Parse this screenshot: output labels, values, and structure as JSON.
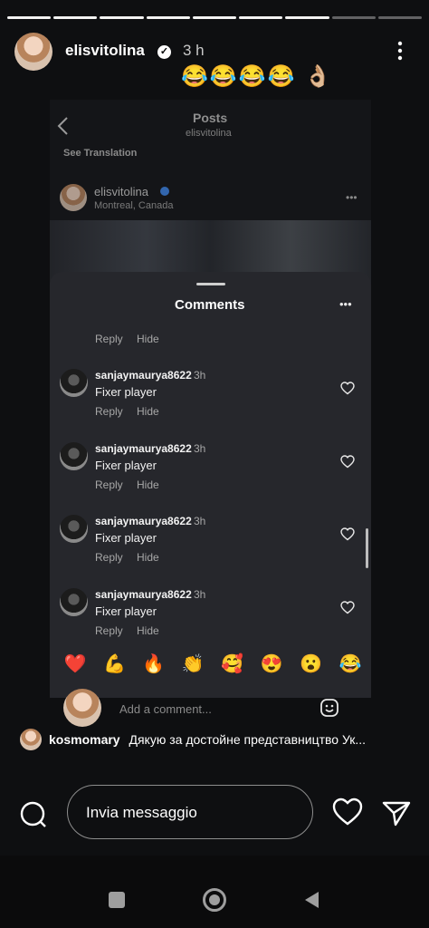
{
  "story": {
    "username": "elisvitolina",
    "time": "3 h",
    "progress_total": 9,
    "progress_filled": 7,
    "header_emoji": "😂😂😂😂 👌🏼"
  },
  "screenshot": {
    "title": "Posts",
    "subtitle": "elisvitolina",
    "see_translation": "See Translation",
    "post_user": "elisvitolina",
    "post_location": "Montreal, Canada",
    "more": "•••",
    "sheet_title": "Comments",
    "sheet_more": "•••",
    "reply_label": "Reply",
    "hide_label": "Hide",
    "comments": [
      {
        "user": "sanjaymaurya8622",
        "time": "3h",
        "text": "Fixer player"
      },
      {
        "user": "sanjaymaurya8622",
        "time": "3h",
        "text": "Fixer player"
      },
      {
        "user": "sanjaymaurya8622",
        "time": "3h",
        "text": "Fixer player"
      },
      {
        "user": "sanjaymaurya8622",
        "time": "3h",
        "text": "Fixer player"
      }
    ],
    "reactions": [
      "❤️",
      "💪",
      "🔥",
      "👏",
      "🥰",
      "😍",
      "😮",
      "😂"
    ],
    "add_comment_placeholder": "Add a comment..."
  },
  "mention": {
    "username": "kosmomary",
    "text": "Дякую за достойне представництво Ук..."
  },
  "composer": {
    "placeholder": "Invia messaggio"
  },
  "colors": {
    "background": "#0e0f11",
    "sheet": "#26272c",
    "verified": "#ffffff"
  }
}
